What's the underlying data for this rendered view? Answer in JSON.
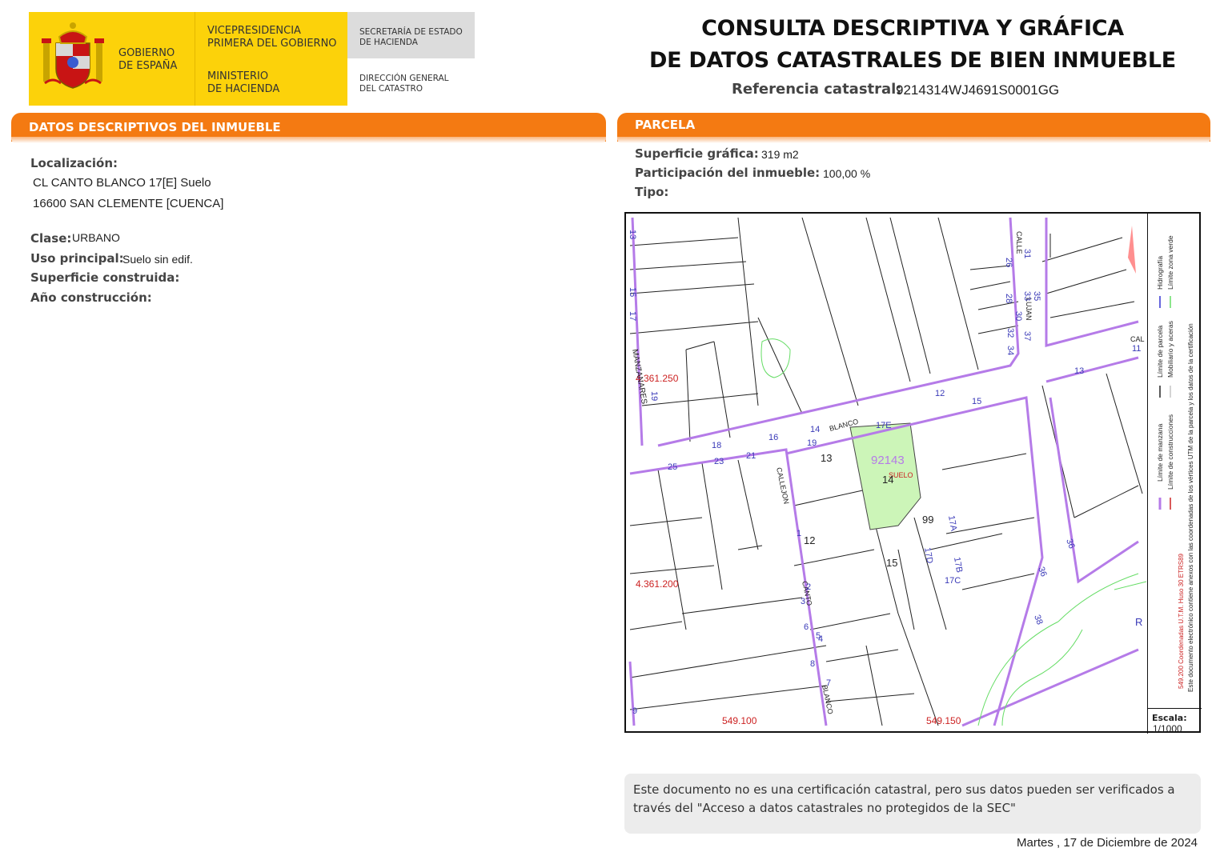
{
  "header": {
    "gov_line1": "GOBIERNO",
    "gov_line2": "DE ESPAÑA",
    "vp_line1": "VICEPRESIDENCIA",
    "vp_line2": "PRIMERA DEL GOBIERNO",
    "min_line1": "MINISTERIO",
    "min_line2": "DE HACIENDA",
    "sec_line1": "SECRETARÍA DE ESTADO",
    "sec_line2": "DE HACIENDA",
    "dir_line1": "DIRECCIÓN GENERAL",
    "dir_line2": "DEL CATASTRO",
    "title_line1": "CONSULTA DESCRIPTIVA Y GRÁFICA",
    "title_line2": "DE DATOS CATASTRALES DE BIEN INMUEBLE",
    "ref_label": "Referencia catastral:",
    "ref_value": "9214314WJ4691S0001GG"
  },
  "descriptive": {
    "section_title": "DATOS DESCRIPTIVOS DEL INMUEBLE",
    "localizacion_label": "Localización:",
    "address_line1": "CL CANTO BLANCO 17[E] Suelo",
    "address_line2": "16600 SAN CLEMENTE [CUENCA]",
    "clase_label": "Clase:",
    "clase_value": "URBANO",
    "uso_label": "Uso principal:",
    "uso_value": "Suelo sin edif.",
    "superficie_label": "Superficie construida:",
    "anio_label": "Año construcción:"
  },
  "parcela": {
    "section_title": "PARCELA",
    "superficie_label": "Superficie gráfica:",
    "superficie_value": "319 m2",
    "participacion_label": "Participación del inmueble:",
    "participacion_value": "100,00 %",
    "tipo_label": "Tipo:"
  },
  "map": {
    "parcel_id": "92143",
    "parcel_sub": "SUELO",
    "coord_y1": "4.361.250",
    "coord_y2": "4.361.200",
    "coord_x1": "549.100",
    "coord_x2": "549.150",
    "streets": [
      "MANZANARES",
      "BLANCO",
      "CALLEJON",
      "CANTO",
      "BLANCO",
      "CALLE",
      "LUJAN",
      "CAL"
    ],
    "numbers": [
      "13",
      "14",
      "99",
      "15",
      "12",
      "17A",
      "17D",
      "17B",
      "17C",
      "17E",
      "12",
      "15",
      "13",
      "14",
      "16",
      "18",
      "19",
      "21",
      "23",
      "25",
      "15",
      "17",
      "19",
      "36",
      "36",
      "38",
      "26",
      "28",
      "30",
      "32",
      "34",
      "31",
      "33",
      "35",
      "37",
      "11",
      "1",
      "2",
      "3",
      "4",
      "5",
      "6",
      "7",
      "8",
      "9",
      "13",
      "R"
    ],
    "legend": {
      "manzana": "Límite de manzana",
      "parcela": "Límite de parcela",
      "hidrografia": "Hidrografía",
      "construcciones": "Límite de construcciones",
      "mobiliario": "Mobiliario y aceras",
      "zona_verde": "Límite zona verde",
      "coords": "549.200 Coordenadas U.T.M. Huso 30 ETRS89",
      "annex": "Este documento electrónico contiene anexos con las coordenadas de los vértices UTM de la parcela y los datos de la certificación"
    },
    "scale_label": "Escala:",
    "scale_value": "1/1000"
  },
  "footer": {
    "note": "Este documento no es una certificación catastral, pero sus datos pueden ser verificados a través del \"Acceso a datos catastrales no protegidos de la SEC\"",
    "date": "Martes , 17 de Diciembre de 2024"
  },
  "colors": {
    "orange": "#f47a12",
    "yellow": "#fcd20a",
    "parcel_fill": "#ccf5b8",
    "block_line": "#b57be8",
    "green_line": "#66dd66",
    "coord_red": "#cc2222"
  }
}
